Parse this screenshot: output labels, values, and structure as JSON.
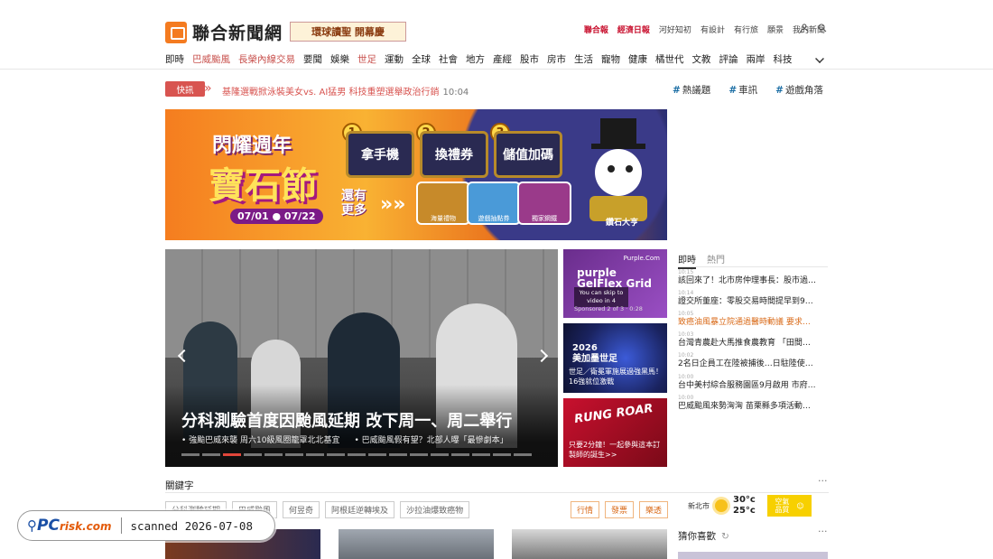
{
  "header": {
    "logo_text": "聯合新聞網",
    "promo_badge": "環球讀聖 開幕慶",
    "top_links": [
      "聯合報",
      "經濟日報",
      "河好知初",
      "有設計",
      "有行旅",
      "願景",
      "我的新聞"
    ]
  },
  "nav": {
    "items": [
      "即時",
      "巴威颱風",
      "長榮內線交易",
      "要聞",
      "娛樂",
      "世足",
      "運動",
      "全球",
      "社會",
      "地方",
      "產經",
      "股市",
      "房市",
      "生活",
      "寵物",
      "健康",
      "橘世代",
      "文教",
      "評論",
      "兩岸",
      "科技"
    ],
    "highlighted": [
      "巴威颱風",
      "長榮內線交易",
      "世足"
    ]
  },
  "breaking": {
    "tag": "快訊",
    "text": "基隆選戰掀泳裝美女vs. AI猛男 科技重塑選舉政治行銷",
    "time": "10:04"
  },
  "hashtags": [
    "熱議題",
    "車訊",
    "遊戲角落"
  ],
  "banner": {
    "title1": "閃耀週年",
    "title2": "寶石節",
    "date": "07/01 ● 07/22",
    "more": "還有更多",
    "steps": [
      {
        "num": "1",
        "label": "拿手機"
      },
      {
        "num": "2",
        "label": "換禮券"
      },
      {
        "num": "3",
        "label": "儲值加碼"
      }
    ],
    "gifts": [
      "海量禮物",
      "遊戲抽點券",
      "獨家鋼鐵"
    ],
    "mascot_label": "鑽石大亨"
  },
  "hero": {
    "caption": "分科測驗首度因颱風延期 改下周一、周二舉行",
    "subs": [
      "強颱巴威來襲 周六10級風圈籠罩北北基宜",
      "巴威颱風假有望？北部人曝「最慘劇本」"
    ],
    "slide_count": 17,
    "active_slide": 3
  },
  "side_thumbs": {
    "t1": {
      "tag": "Purple.Com",
      "brand": "purple\nGelFlex Grid",
      "skip": "You can skip to video in 4",
      "sponsored": "Sponsored 2 of 3 · 0:28"
    },
    "t2": {
      "headline": "2026\n美加墨世足",
      "caption": "世足／衛冕軍施展過強黑馬！16強就位激戰"
    },
    "t3": {
      "headline": "RUNG ROAR",
      "caption": "只要2分鐘！一起參與這本訂製師的誕生>>"
    }
  },
  "news_tabs": [
    "即時",
    "熱門"
  ],
  "news": [
    {
      "time": "10:15",
      "text": "該回來了！北市房仲理事長：股市過…",
      "color": "normal"
    },
    {
      "time": "10:14",
      "text": "證交所董座：零股交易時間提早到9…",
      "color": "normal"
    },
    {
      "time": "10:05",
      "text": "致癌油風暴立院通過醫時動議 要求…",
      "color": "orange"
    },
    {
      "time": "10:03",
      "text": "台灣青農赴大馬推食農教育 「田間…",
      "color": "normal"
    },
    {
      "time": "10:02",
      "text": "2名日企員工在陸被捕後…日駐陸使…",
      "color": "normal"
    },
    {
      "time": "10:00",
      "text": "台中美村綜合服務園區9月啟用 市府…",
      "color": "normal"
    },
    {
      "time": "10:00",
      "text": "巴威颱風來勢洶洶 苗栗縣多項活動…",
      "color": "normal"
    }
  ],
  "keywords": {
    "title": "關鍵字",
    "chips": [
      "分科測驗延期",
      "巴威颱風",
      "何昱奇",
      "阿根廷逆轉埃及",
      "沙拉油爆致癌物"
    ],
    "chips2": [
      "行情",
      "發票",
      "樂透"
    ]
  },
  "weather": {
    "city": "新北市",
    "high": "30°c",
    "low": "25°c",
    "box_label": "空氣品質"
  },
  "guess": {
    "title": "猜你喜歡"
  },
  "watermark": {
    "brand": "PC",
    "brand_suffix": "risk.com",
    "text": "scanned 2026-07-08"
  },
  "colors": {
    "brand": "#f47b20",
    "accent": "#c8504c",
    "breaking": "#d85450",
    "link": "#1d6fa5"
  }
}
